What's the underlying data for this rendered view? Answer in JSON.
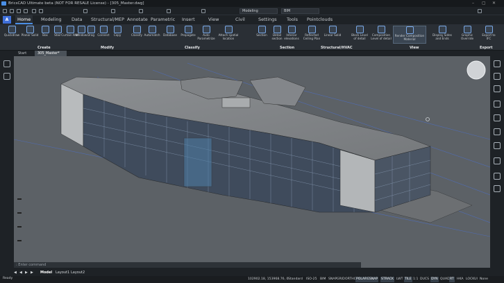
{
  "window": {
    "title": "BricsCAD Ultimate beta (NOT FOR RESALE License) - [305_Master.dwg]"
  },
  "quick_access": {
    "workspace": "Modeling",
    "layer": "BIM"
  },
  "tabs": [
    "Home",
    "Modeling",
    "Data",
    "Structural/MEP",
    "Annotate",
    "Parametric",
    "Insert",
    "View",
    "Civil",
    "Settings",
    "Tools",
    "Pointclouds"
  ],
  "active_tab": "Home",
  "app_button": "A",
  "ribbon": {
    "create": {
      "label": "Create",
      "buttons": [
        "Quickdraw",
        "Planar Solid",
        "Box",
        "Stair",
        "Curtain Wall",
        "Window"
      ]
    },
    "modify": {
      "label": "Modify",
      "buttons": [
        "Drag",
        "Connect",
        "Copy"
      ]
    },
    "classify": {
      "label": "Classify",
      "buttons": [
        "Classify",
        "Automatch",
        "Database",
        "Propagate",
        "Auto Parametrize",
        "Attach spatial location"
      ]
    },
    "section": {
      "label": "Section",
      "buttons": [
        "Section",
        "Detail section",
        "Interior elevations",
        "Reflected Ceiling Plan"
      ]
    },
    "structural": {
      "label": "Structural/HVAC",
      "buttons": [
        "Linear Solid"
      ]
    },
    "view": {
      "label": "View",
      "buttons": [
        "Block Level of detail",
        "Composition Level of detail",
        "Render Composition Material",
        "Display Sides and Ends",
        "Graphic Override"
      ]
    },
    "export": {
      "label": "Export",
      "buttons": [
        "Export to IFC"
      ]
    }
  },
  "doc_tabs": [
    "Start",
    "305_Master*"
  ],
  "command": {
    "placeholder": "Enter command"
  },
  "layouts": [
    "Model",
    "Layout1",
    "Layout2"
  ],
  "status": {
    "ready": "Ready",
    "coords": "102902.18, 153968.76, 0",
    "style": "Standard",
    "dimstyle": "ISO-25",
    "workspace": "BIM",
    "toggles": [
      "SNAP",
      "GRID",
      "ORTHO",
      "POLAR",
      "ESNAP",
      "STRACK",
      "LWT",
      "TILE",
      "1:1",
      "DUCS",
      "DYN",
      "QUAD",
      "RT",
      "HKA",
      "LOCKUI",
      "None"
    ]
  }
}
